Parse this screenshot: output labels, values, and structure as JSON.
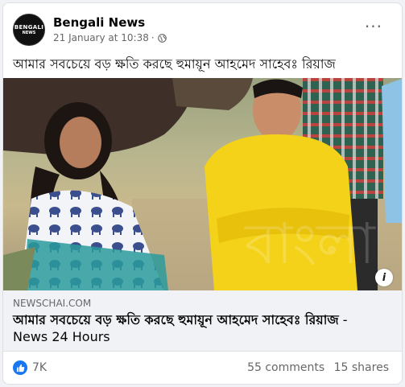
{
  "post": {
    "page_name": "Bengali News",
    "avatar_line1": "BENGALI",
    "avatar_line2": "NEWS",
    "date": "21 January at 10:38",
    "separator": "·",
    "more": "···",
    "text": "আমার সবচেয়ে বড় ক্ষতি করছে হুমায়ূন আহমেদ সাহেবঃ রিয়াজ"
  },
  "link": {
    "domain": "NEWSCHAI.COM",
    "title": "আমার সবচেয়ে বড় ক্ষতি করছে হুমায়ূন আহমেদ সাহেবঃ রিয়াজ",
    "source": " - News 24 Hours",
    "info": "i"
  },
  "stats": {
    "reactions": "7K",
    "comments": "55 comments",
    "shares": "15 shares"
  },
  "colors": {
    "accent": "#1877f2",
    "shirt": "#f5d21a",
    "muted": "#65676b"
  },
  "icons": [
    "globe-icon",
    "more-options-icon",
    "info-icon",
    "like-reaction-icon"
  ]
}
